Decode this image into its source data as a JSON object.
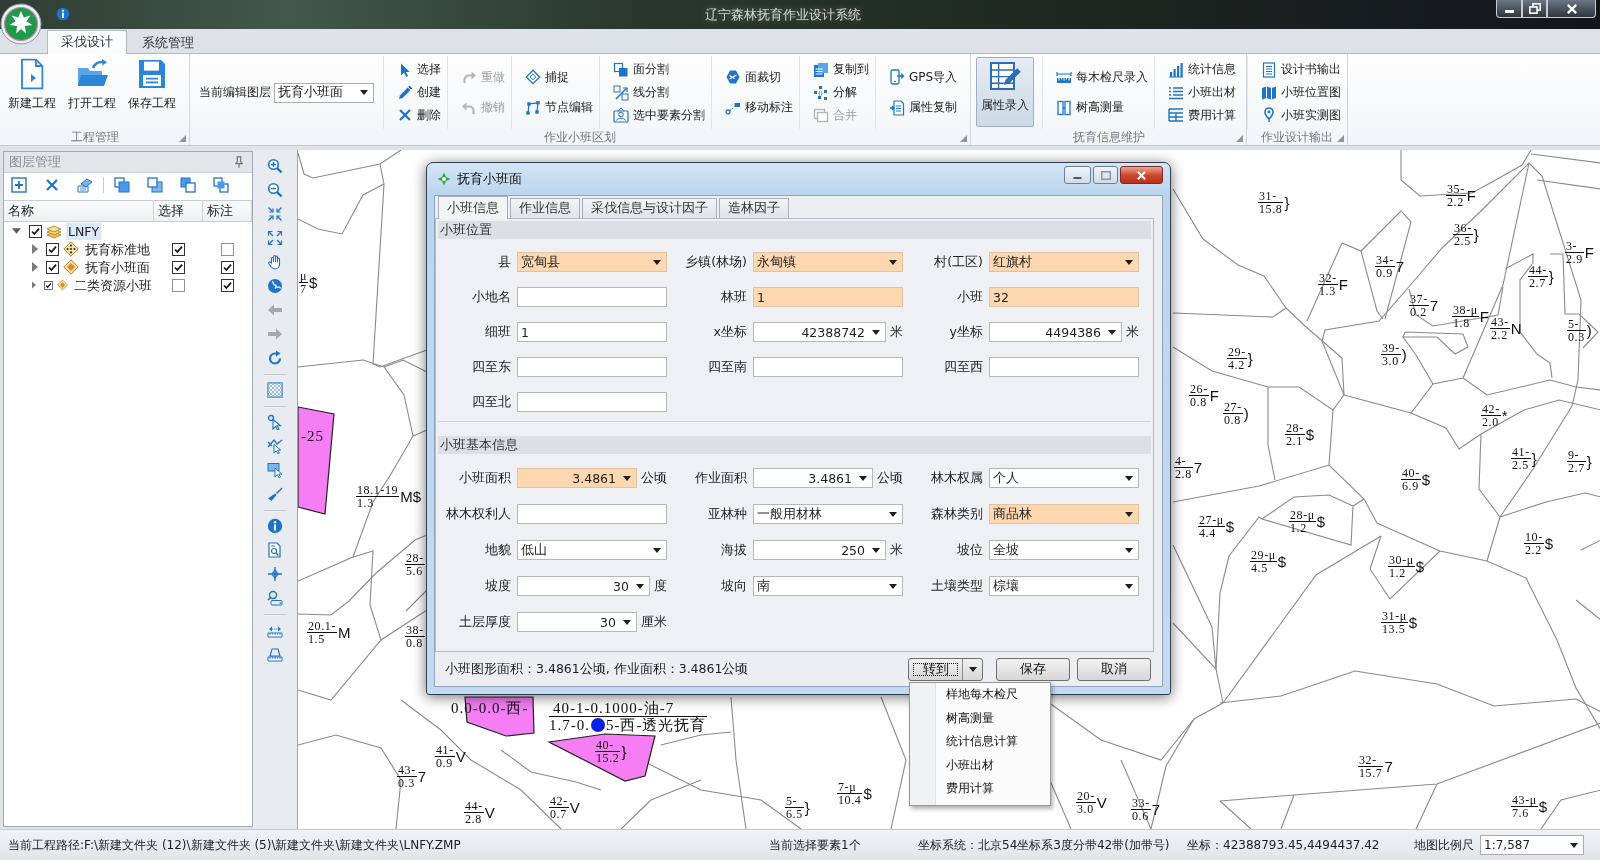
{
  "window": {
    "title": "辽宁森林抚育作业设计系统"
  },
  "ribbon_tabs": [
    {
      "label": "采伐设计",
      "selected": true
    },
    {
      "label": "系统管理",
      "selected": false
    }
  ],
  "ribbon": [
    {
      "label": "工程管理",
      "items": [
        {
          "kind": "large",
          "label": "新建工程",
          "pressed": false
        },
        {
          "kind": "large",
          "label": "打开工程",
          "pressed": false
        },
        {
          "kind": "large",
          "label": "保存工程",
          "pressed": false
        }
      ]
    },
    {
      "label": "作业小班区划",
      "items": [
        {
          "kind": "combo",
          "label": "当前编辑图层",
          "value": "抚育小班面"
        },
        {
          "kind": "column",
          "buttons": [
            {
              "label": "选择",
              "disabled": false
            },
            {
              "label": "创建",
              "disabled": false
            },
            {
              "label": "删除",
              "disabled": false
            }
          ]
        },
        {
          "kind": "column",
          "buttons": [
            {
              "label": "重做",
              "disabled": true
            },
            {
              "label": "撤销",
              "disabled": true
            }
          ]
        },
        {
          "kind": "column",
          "buttons": [
            {
              "label": "捕捉",
              "disabled": false
            },
            {
              "label": "节点编辑",
              "disabled": false
            }
          ]
        },
        {
          "kind": "column",
          "buttons": [
            {
              "label": "面分割",
              "disabled": false
            },
            {
              "label": "线分割",
              "disabled": false
            },
            {
              "label": "选中要素分割",
              "disabled": false
            }
          ]
        },
        {
          "kind": "column",
          "buttons": [
            {
              "label": "面裁切",
              "disabled": false
            },
            {
              "label": "移动标注",
              "disabled": false
            }
          ]
        },
        {
          "kind": "column",
          "buttons": [
            {
              "label": "复制到",
              "disabled": false
            },
            {
              "label": "分解",
              "disabled": false
            },
            {
              "label": "合并",
              "disabled": true
            }
          ]
        },
        {
          "kind": "column",
          "buttons": [
            {
              "label": "GPS导入",
              "disabled": false
            },
            {
              "label": "属性复制",
              "disabled": false
            }
          ]
        }
      ]
    },
    {
      "label": "抚育信息维护",
      "items": [
        {
          "kind": "large",
          "label": "属性录入",
          "pressed": true
        },
        {
          "kind": "column",
          "buttons": [
            {
              "label": "每木检尺录入",
              "disabled": false
            },
            {
              "label": "树高测量",
              "disabled": false
            }
          ]
        },
        {
          "kind": "column",
          "buttons": [
            {
              "label": "统计信息",
              "disabled": false
            },
            {
              "label": "小班出材",
              "disabled": false
            },
            {
              "label": "费用计算",
              "disabled": false
            }
          ]
        }
      ]
    },
    {
      "label": "作业设计输出",
      "items": [
        {
          "kind": "column",
          "buttons": [
            {
              "label": "设计书输出",
              "disabled": false
            },
            {
              "label": "小班位置图",
              "disabled": false
            },
            {
              "label": "小班实测图",
              "disabled": false
            }
          ]
        }
      ]
    }
  ],
  "layer_panel": {
    "title": "图层管理",
    "columns": [
      "名称",
      "选择",
      "标注"
    ],
    "layers": [
      {
        "label": "LNFY",
        "kind": "group",
        "checked": true,
        "expanded": true,
        "selected": true,
        "children": [
          {
            "label": "抚育标准地",
            "kind": "point",
            "checked": true,
            "expanded": false,
            "selected": false,
            "selectable": true,
            "labeled": false
          },
          {
            "label": "抚育小班面",
            "kind": "polygon",
            "checked": true,
            "expanded": false,
            "selected": false,
            "selectable": true,
            "labeled": true
          },
          {
            "label": "二类资源小班",
            "kind": "polygon",
            "checked": true,
            "expanded": false,
            "selected": false,
            "selectable": false,
            "labeled": true
          }
        ]
      }
    ]
  },
  "map": {
    "labels": [
      {
        "upper": "μ",
        "lower": "7",
        "mark": "$"
      },
      {
        "upper": "18.1-19",
        "lower": "1.3",
        "mark": "M$"
      },
      {
        "upper": "28-",
        "lower": "5.6"
      },
      {
        "upper": "20.1-",
        "lower": "1.5",
        "mark": "M"
      },
      {
        "upper": "38-",
        "lower": "0.8"
      },
      {
        "upper": "31-",
        "lower": "15.8",
        "mark": "}"
      },
      {
        "upper": "35-",
        "lower": "2.2",
        "mark": "F"
      },
      {
        "upper": "36-",
        "lower": "2.5",
        "mark": "}"
      },
      {
        "upper": "3-",
        "lower": "2.9",
        "mark": "F"
      },
      {
        "upper": "34-",
        "lower": "0.9",
        "mark": "7"
      },
      {
        "upper": "32-",
        "lower": "1.3",
        "mark": "F"
      },
      {
        "upper": "44-",
        "lower": "2.7",
        "mark": "}"
      },
      {
        "upper": "37-",
        "lower": "0.2",
        "mark": "7"
      },
      {
        "upper": "38-μ",
        "lower": "1.8",
        "mark": "F"
      },
      {
        "upper": "43-",
        "lower": "2.2",
        "mark": "N"
      },
      {
        "upper": "5-",
        "lower": "0.3",
        "mark": ")"
      },
      {
        "upper": "29-",
        "lower": "4.2",
        "mark": "}"
      },
      {
        "upper": "39-",
        "lower": "3.0",
        "mark": ")"
      },
      {
        "upper": "26-",
        "lower": "0.8",
        "mark": "F"
      },
      {
        "upper": "27-",
        "lower": "0.8",
        "mark": ")"
      },
      {
        "upper": "28-",
        "lower": "2.1",
        "mark": "$"
      },
      {
        "upper": "42-",
        "lower": "2.0",
        "mark": "*"
      },
      {
        "upper": "4-",
        "lower": "2.8",
        "mark": "7"
      },
      {
        "upper": "41-",
        "lower": "2.5",
        "mark": "}"
      },
      {
        "upper": "9-",
        "lower": "2.7",
        "mark": "}"
      },
      {
        "upper": "40-",
        "lower": "6.9",
        "mark": "$"
      },
      {
        "upper": "27-μ",
        "lower": "4.4",
        "mark": "$"
      },
      {
        "upper": "28-μ",
        "lower": "1.2",
        "mark": "$"
      },
      {
        "upper": "10-",
        "lower": "2.2",
        "mark": "$"
      },
      {
        "upper": "29-μ",
        "lower": "4.5",
        "mark": "$"
      },
      {
        "upper": "30-μ",
        "lower": "1.2",
        "mark": "$"
      },
      {
        "upper": "31-μ",
        "lower": "13.5",
        "mark": "$"
      },
      {
        "upper": "32-",
        "lower": "15.7",
        "mark": "7"
      },
      {
        "upper": "43-μ",
        "lower": "7.6",
        "mark": "$"
      },
      {
        "upper": "40-",
        "lower": "15.2",
        "mark": "}"
      },
      {
        "upper": "41-",
        "lower": "0.9",
        "mark": "V"
      },
      {
        "upper": "43-",
        "lower": "0.3",
        "mark": "7"
      },
      {
        "upper": "44-",
        "lower": "2.8",
        "mark": "V"
      },
      {
        "upper": "42-",
        "lower": "0.7",
        "mark": "V"
      },
      {
        "upper": "5-",
        "lower": "6.5",
        "mark": "}"
      },
      {
        "upper": "7-μ",
        "lower": "10.4",
        "mark": "$"
      },
      {
        "upper": "20-",
        "lower": "3.0",
        "mark": "V"
      },
      {
        "upper": "33-",
        "lower": "0.6",
        "mark": "7"
      }
    ],
    "notes": [
      "-25",
      "0.0-0.0-西-"
    ],
    "selected_label": {
      "upper": "40-1-0.1000-油-7",
      "lower": [
        "1.7-0.",
        "5-西-透光抚育"
      ]
    }
  },
  "dialog": {
    "title": "抚育小班面",
    "tabs": [
      {
        "label": "小班信息",
        "selected": true
      },
      {
        "label": "作业信息",
        "selected": false
      },
      {
        "label": "采伐信息与设计因子",
        "selected": false
      },
      {
        "label": "造林因子",
        "selected": false
      }
    ],
    "sections": [
      {
        "title": "小班位置",
        "fields": [
          {
            "label": "县",
            "kind": "combo",
            "value": "宽甸县",
            "required": true
          },
          {
            "label": "乡镇(林场)",
            "kind": "combo",
            "value": "永甸镇",
            "required": true
          },
          {
            "label": "村(工区)",
            "kind": "combo",
            "value": "红旗村",
            "required": true
          },
          {
            "label": "小地名",
            "kind": "text",
            "required": false
          },
          {
            "label": "林班",
            "kind": "text",
            "value": "1",
            "required": true
          },
          {
            "label": "小班",
            "kind": "text",
            "value": "32",
            "required": true
          },
          {
            "label": "细班",
            "kind": "text",
            "value": "1",
            "required": false
          },
          {
            "label": "x坐标",
            "kind": "number",
            "value": "42388742",
            "unit": "米",
            "required": false
          },
          {
            "label": "y坐标",
            "kind": "number",
            "value": "4494386",
            "unit": "米",
            "required": false
          },
          {
            "label": "四至东",
            "kind": "text",
            "required": false
          },
          {
            "label": "四至南",
            "kind": "text",
            "required": false
          },
          {
            "label": "四至西",
            "kind": "text",
            "required": false
          },
          {
            "label": "四至北",
            "kind": "text",
            "required": false
          }
        ]
      },
      {
        "title": "小班基本信息",
        "fields": [
          {
            "label": "小班面积",
            "kind": "number",
            "value": "3.4861",
            "unit": "公顷",
            "required": true
          },
          {
            "label": "作业面积",
            "kind": "number",
            "value": "3.4861",
            "unit": "公顷",
            "required": false
          },
          {
            "label": "林木权属",
            "kind": "combo",
            "value": "个人",
            "required": false
          },
          {
            "label": "林木权利人",
            "kind": "text",
            "required": false
          },
          {
            "label": "亚林种",
            "kind": "combo",
            "value": "一般用材林",
            "required": false
          },
          {
            "label": "森林类别",
            "kind": "combo",
            "value": "商品林",
            "required": true
          },
          {
            "label": "地貌",
            "kind": "combo",
            "value": "低山",
            "required": false
          },
          {
            "label": "海拔",
            "kind": "number",
            "value": "250",
            "unit": "米",
            "required": false
          },
          {
            "label": "坡位",
            "kind": "combo",
            "value": "全坡",
            "required": false
          },
          {
            "label": "坡度",
            "kind": "number",
            "value": "30",
            "unit": "度",
            "required": false
          },
          {
            "label": "坡向",
            "kind": "combo",
            "value": "南",
            "required": false
          },
          {
            "label": "土壤类型",
            "kind": "combo",
            "value": "棕壤",
            "required": false
          },
          {
            "label": "土层厚度",
            "kind": "number",
            "value": "30",
            "unit": "厘米",
            "required": false
          }
        ]
      }
    ],
    "summary": "小班图形面积：3.4861公顷, 作业面积：3.4861公顷",
    "buttons": [
      {
        "label": "转到",
        "kind": "split",
        "focused": true
      },
      {
        "label": "保存",
        "kind": "plain",
        "focused": false
      },
      {
        "label": "取消",
        "kind": "plain",
        "focused": false
      }
    ],
    "menu": [
      "样地每木检尺",
      "树高测量",
      "统计信息计算",
      "小班出材",
      "费用计算"
    ]
  },
  "status_bar": {
    "path": "当前工程路径:F:\\新建文件夹 (12)\\新建文件夹 (5)\\新建文件夹\\新建文件夹\\LNFY.ZMP",
    "selection": "当前选择要素1个",
    "coordinate_system": "坐标系统：北京54坐标系3度分带42带(加带号)",
    "coordinates": "坐标：42388793.45,4494437.42",
    "scale_label": "地图比例尺",
    "scale": "1:7,587"
  }
}
